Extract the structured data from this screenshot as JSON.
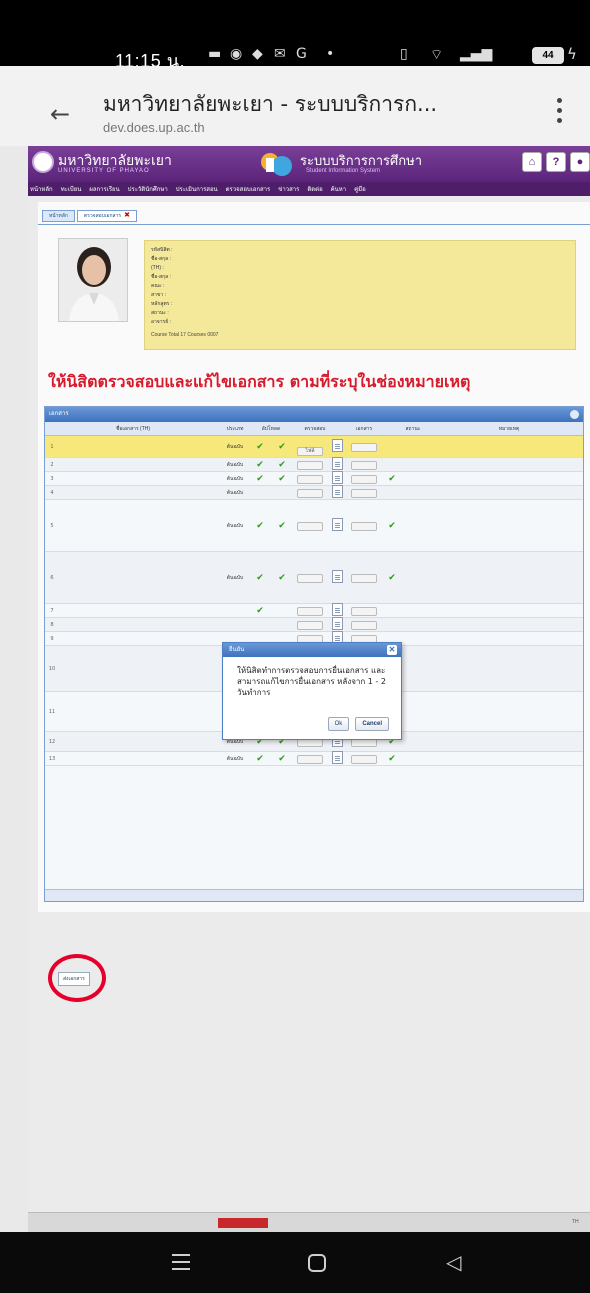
{
  "status_bar": {
    "time": "11:15 น.",
    "notification_icons": [
      "image-icon",
      "messenger-icon",
      "chat-icon",
      "mail-icon",
      "google-icon",
      "dot-icon"
    ],
    "system_icons": [
      "vibrate-icon",
      "wifi-icon",
      "signal-icon"
    ],
    "battery": "44"
  },
  "browser": {
    "title": "มหาวิทยาลัยพะเยา - ระบบบริการก...",
    "url": "dev.does.up.ac.th"
  },
  "site": {
    "university_th": "มหาวิทยาลัยพะเยา",
    "university_en": "UNIVERSITY OF PHAYAO",
    "system_th": "ระบบบริการการศึกษา",
    "system_en": "Student Information System",
    "nav": [
      "หน้าหลัก",
      "ทะเบียน",
      "ผลการเรียน",
      "ประวัตินักศึกษา",
      "ประเมินการสอน",
      "ตรวจสอบเอกสาร",
      "ข่าวสาร",
      "ติดต่อ",
      "ค้นหา",
      "คู่มือ"
    ]
  },
  "tabs": [
    {
      "label": "หน้าหลัก"
    },
    {
      "label": "ตรวจสอบเอกสาร"
    }
  ],
  "profile": {
    "rows": [
      {
        "label": "รหัสนิสิต :",
        "value": ""
      },
      {
        "label": "ชื่อ-สกุล :",
        "value": ""
      },
      {
        "label": "(TH) :",
        "value": ""
      },
      {
        "label": "ชื่อ-สกุล :",
        "value": ""
      },
      {
        "label": "คณะ :",
        "value": ""
      },
      {
        "label": "สาขา :",
        "value": ""
      },
      {
        "label": "หลักสูตร :",
        "value": ""
      },
      {
        "label": "สถานะ :",
        "value": ""
      },
      {
        "label": "อาจารย์ :",
        "value": ""
      }
    ],
    "note": "Course Total 17 Courses 0007"
  },
  "notice": "ให้นิสิตตรวจสอบและแก้ไขเอกสาร ตามที่ระบุในช่องหมายเหตุ",
  "grid": {
    "title": "เอกสาร",
    "headers": [
      "ชื่อเอกสาร (TH)",
      "ประเภท",
      "อัปโหลด",
      "ตรวจสอบ",
      "เอกสาร",
      "สถานะ",
      "หมายเหตุ"
    ],
    "rows": [
      {
        "no": "1",
        "doc": "",
        "type": "ต้นฉบับ",
        "checks": 2,
        "btn": "ไฟล์",
        "highlight": true
      },
      {
        "no": "2",
        "doc": "",
        "type": "ต้นฉบับ",
        "checks": 2,
        "btn": "",
        "highlight": false
      },
      {
        "no": "3",
        "doc": "",
        "type": "ต้นฉบับ",
        "checks": 3,
        "btn": "",
        "highlight": false
      },
      {
        "no": "4",
        "doc": "",
        "type": "ต้นฉบับ",
        "checks": 0,
        "btn": "",
        "highlight": false
      },
      {
        "no": "5",
        "doc": "",
        "type": "ต้นฉบับ",
        "checks": 3,
        "btn": "",
        "highlight": false
      },
      {
        "no": "6",
        "doc": "",
        "type": "ต้นฉบับ",
        "checks": 3,
        "btn": "",
        "highlight": false
      },
      {
        "no": "7",
        "doc": "",
        "type": "",
        "checks": 1,
        "btn": "",
        "highlight": false
      },
      {
        "no": "8",
        "doc": "",
        "type": "",
        "checks": 0,
        "btn": "",
        "highlight": false
      },
      {
        "no": "9",
        "doc": "",
        "type": "",
        "checks": 0,
        "btn": "",
        "highlight": false
      },
      {
        "no": "10",
        "doc": "",
        "type": "ต้นฉบับ",
        "checks": 3,
        "btn": "",
        "highlight": false
      },
      {
        "no": "11",
        "doc": "",
        "type": "ต้นฉบับ",
        "checks": 3,
        "btn": "",
        "highlight": false
      },
      {
        "no": "12",
        "doc": "",
        "type": "ต้นฉบับ",
        "checks": 3,
        "btn": "",
        "highlight": false
      },
      {
        "no": "13",
        "doc": "",
        "type": "ต้นฉบับ",
        "checks": 3,
        "btn": "",
        "highlight": false
      }
    ],
    "footer_left": "",
    "footer_right": ""
  },
  "dialog": {
    "title": "ยืนยัน",
    "message": "ให้นิสิตทำการตรวจสอบการยื่นเอกสาร และสามารถแก้ไขการยื่นเอกสาร หลังจาก 1 - 2 วันทำการ",
    "ok": "Ok",
    "cancel": "Cancel"
  },
  "send_button": "ส่งเอกสาร",
  "page_footer": {
    "left": "",
    "mid": "",
    "red": "",
    "right": "",
    "lang": "TH"
  },
  "colors": {
    "header_purple": "#5a2479",
    "notice_red": "#d81b2c",
    "highlight_yellow": "#f6e87a",
    "grid_blue": "#3f72bd",
    "check_green": "#2e9a1c",
    "annotation_red": "#e4002b"
  }
}
